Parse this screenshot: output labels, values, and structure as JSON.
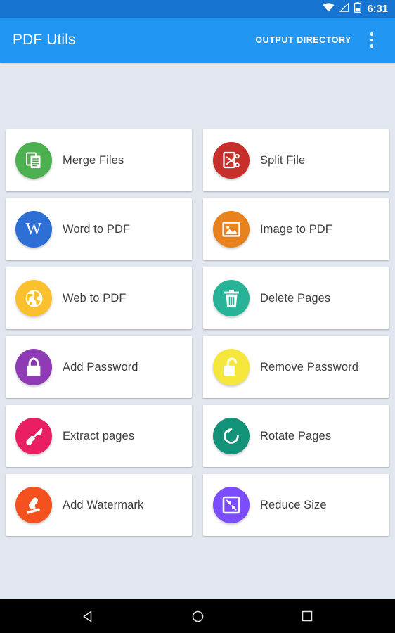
{
  "status_bar": {
    "time": "6:31",
    "icons": [
      "wifi-icon",
      "cell-signal-icon",
      "battery-icon"
    ],
    "background_color": "#1775d1"
  },
  "toolbar": {
    "title": "PDF Utils",
    "action_label": "OUTPUT DIRECTORY",
    "overflow_icon": "more-vertical-icon",
    "background_color": "#2196f3",
    "text_color": "#ffffff"
  },
  "page": {
    "background_color": "#e2e6ee",
    "card_background_color": "#ffffff",
    "label_color": "#3d3d3d"
  },
  "tools": [
    {
      "label": "Merge Files",
      "icon": "merge-documents-icon",
      "color": "#4caf50"
    },
    {
      "label": "Split File",
      "icon": "split-scissors-icon",
      "color": "#c62f2a"
    },
    {
      "label": "Word to PDF",
      "icon": "word-w-icon",
      "color": "#2d6fd4"
    },
    {
      "label": "Image to PDF",
      "icon": "image-picture-icon",
      "color": "#e8821e"
    },
    {
      "label": "Web to PDF",
      "icon": "globe-web-icon",
      "color": "#fbc02d"
    },
    {
      "label": "Delete Pages",
      "icon": "trash-can-icon",
      "color": "#26b397"
    },
    {
      "label": "Add Password",
      "icon": "lock-closed-icon",
      "color": "#8e3bb5"
    },
    {
      "label": "Remove Password",
      "icon": "lock-open-icon",
      "color": "#f5e63c"
    },
    {
      "label": "Extract pages",
      "icon": "shovel-extract-icon",
      "color": "#e91e63"
    },
    {
      "label": "Rotate Pages",
      "icon": "rotate-ccw-icon",
      "color": "#119279"
    },
    {
      "label": "Add Watermark",
      "icon": "stamp-icon",
      "color": "#f4511e"
    },
    {
      "label": "Reduce Size",
      "icon": "compress-arrows-icon",
      "color": "#7c4dff"
    }
  ],
  "nav_bar": {
    "back_label": "back-button",
    "home_label": "home-button",
    "recents_label": "recents-button",
    "background_color": "#000000"
  }
}
